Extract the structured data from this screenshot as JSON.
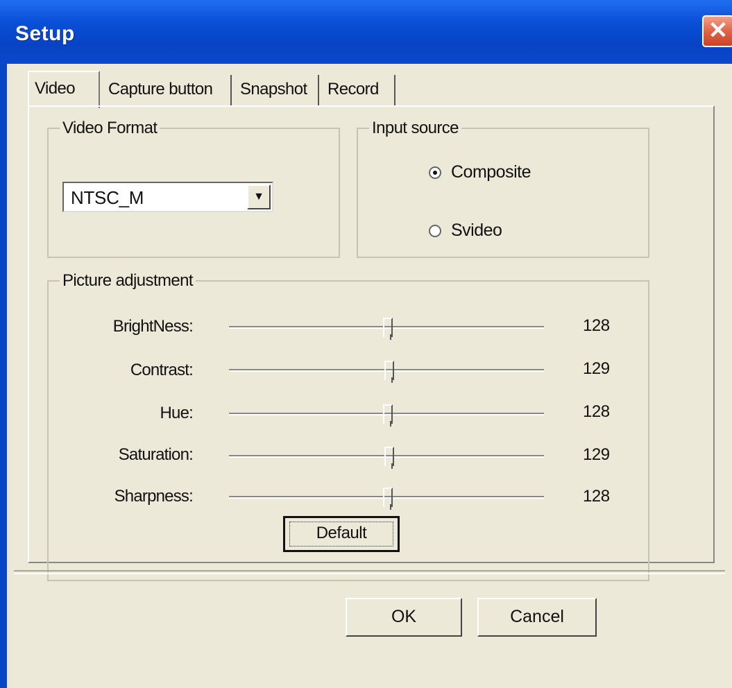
{
  "window": {
    "title": "Setup",
    "close_glyph": "✕"
  },
  "tabs": [
    {
      "label": "Video",
      "active": true
    },
    {
      "label": "Capture button",
      "active": false
    },
    {
      "label": "Snapshot",
      "active": false
    },
    {
      "label": "Record",
      "active": false
    }
  ],
  "video_format": {
    "legend": "Video Format",
    "selected": "NTSC_M",
    "arrow_glyph": "▼"
  },
  "input_source": {
    "legend": "Input source",
    "options": [
      {
        "label": "Composite",
        "checked": true
      },
      {
        "label": "Svideo",
        "checked": false
      }
    ]
  },
  "picture_adjustment": {
    "legend": "Picture adjustment",
    "sliders": [
      {
        "label": "BrightNess:",
        "value": "128"
      },
      {
        "label": "Contrast:",
        "value": "129"
      },
      {
        "label": "Hue:",
        "value": "128"
      },
      {
        "label": "Saturation:",
        "value": "129"
      },
      {
        "label": "Sharpness:",
        "value": "128"
      }
    ],
    "default_label": "Default"
  },
  "footer": {
    "ok_label": "OK",
    "cancel_label": "Cancel"
  },
  "colors": {
    "titlebar": "#0846c8",
    "client": "#ece9d8",
    "close": "#e06445"
  }
}
